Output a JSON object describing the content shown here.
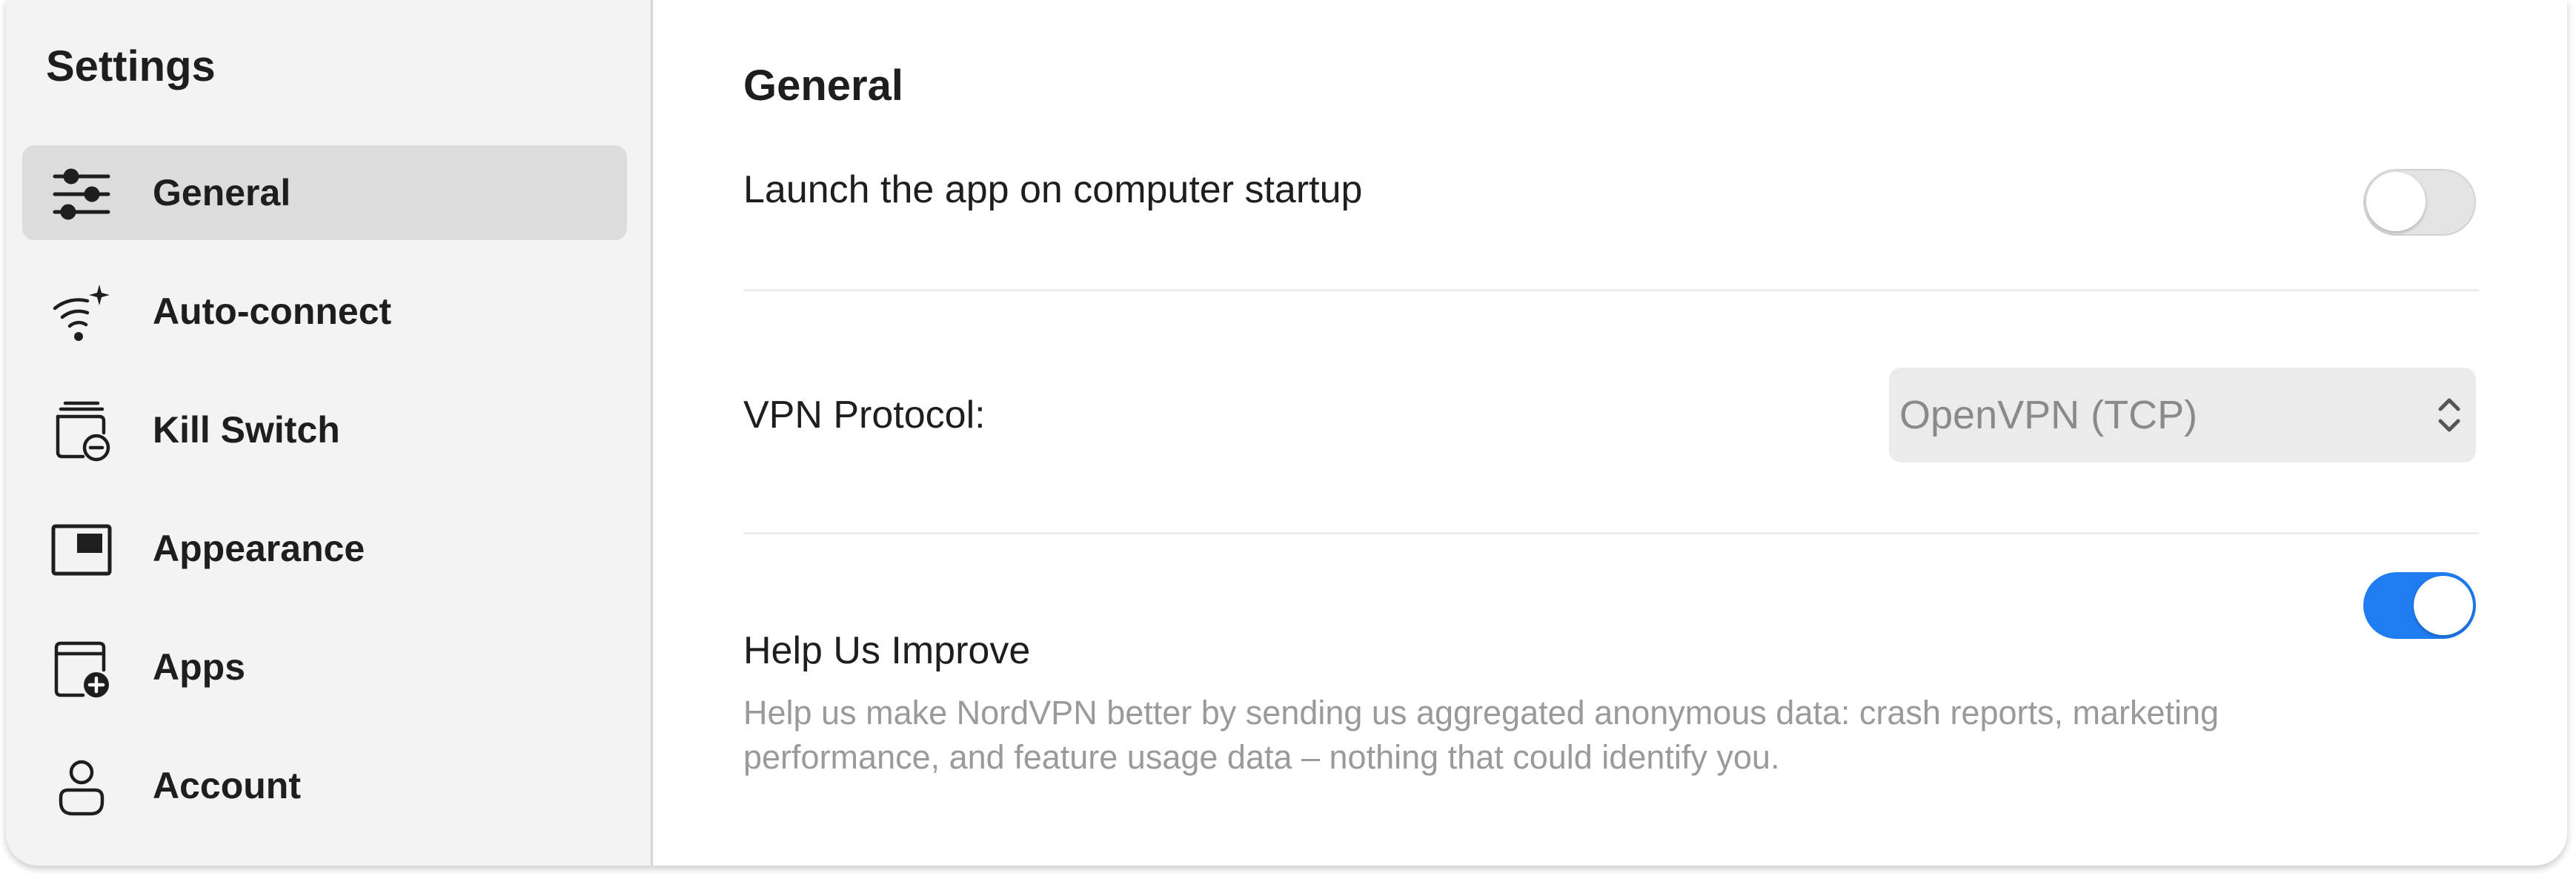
{
  "sidebar": {
    "title": "Settings",
    "items": [
      {
        "label": "General",
        "icon": "sliders-icon",
        "active": true
      },
      {
        "label": "Auto-connect",
        "icon": "wifi-sparkle-icon",
        "active": false
      },
      {
        "label": "Kill Switch",
        "icon": "kill-switch-icon",
        "active": false
      },
      {
        "label": "Appearance",
        "icon": "appearance-icon",
        "active": false
      },
      {
        "label": "Apps",
        "icon": "apps-add-icon",
        "active": false
      },
      {
        "label": "Account",
        "icon": "person-icon",
        "active": false
      }
    ]
  },
  "main": {
    "title": "General",
    "launch_on_startup": {
      "label": "Launch the app on computer startup",
      "enabled": false
    },
    "vpn_protocol": {
      "label": "VPN Protocol:",
      "value": "OpenVPN (TCP)"
    },
    "help_improve": {
      "label": "Help Us Improve",
      "description": "Help us make NordVPN better by sending us aggregated anonymous data: crash reports, marketing performance, and feature usage data – nothing that could identify you.",
      "enabled": true
    }
  },
  "colors": {
    "accent": "#1f7cf1",
    "sidebar_bg": "#f3f3f3",
    "active_item_bg": "#dcdcdc",
    "muted_text": "#9a9a9a"
  }
}
